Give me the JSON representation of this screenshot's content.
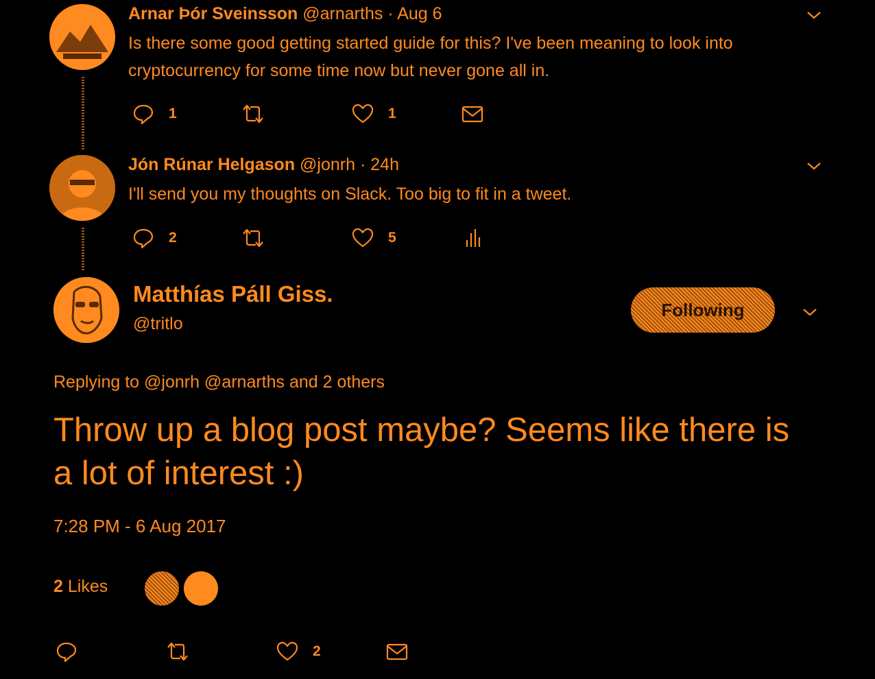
{
  "colors": {
    "accent": "#ff8a1f",
    "background": "#000000"
  },
  "replies": [
    {
      "name": "Arnar Þór Sveinsson",
      "handle": "@arnarths",
      "separator": "·",
      "time": "Aug 6",
      "text": "Is there some good getting started guide for this? I've been meaning to look into cryptocurrency for some time now but never gone all in.",
      "reply_count": "1",
      "retweet_count": "",
      "like_count": "1",
      "extra_action_icon": "mail-icon"
    },
    {
      "name": "Jón Rúnar Helgason",
      "handle": "@jonrh",
      "separator": "·",
      "time": "24h",
      "text": "I'll send you my thoughts on Slack. Too big to fit in a tweet.",
      "reply_count": "2",
      "retweet_count": "",
      "like_count": "5",
      "extra_action_icon": "analytics-icon"
    }
  ],
  "main_tweet": {
    "name": "Matthías Páll Giss.",
    "handle": "@tritlo",
    "follow_label": "Following",
    "replying_to": "Replying to @jonrh @arnarths and 2 others",
    "text": "Throw up a blog post maybe? Seems like there is a lot of interest :)",
    "timestamp": "7:28 PM - 6 Aug 2017",
    "likes_count": "2",
    "likes_label": "Likes",
    "reply_count": "",
    "retweet_count": "",
    "like_count": "2"
  }
}
